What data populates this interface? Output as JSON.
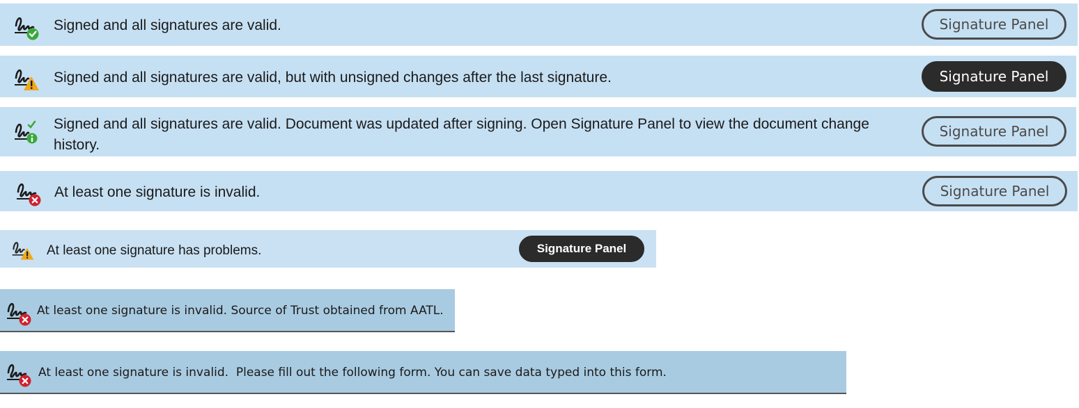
{
  "banners": [
    {
      "message": "Signed and all signatures are valid.",
      "button": "Signature Panel",
      "status_icon": "signature-valid-icon"
    },
    {
      "message": "Signed and all signatures are valid, but with unsigned changes after the last signature.",
      "button": "Signature Panel",
      "status_icon": "signature-warning-icon"
    },
    {
      "message": "Signed and all signatures are valid. Document was updated after signing. Open Signature Panel to view the document change history.",
      "button": "Signature Panel",
      "status_icon": "signature-info-icon"
    },
    {
      "message": "At least one signature is invalid.",
      "button": "Signature Panel",
      "status_icon": "signature-invalid-icon"
    },
    {
      "message": "At least one signature has problems.",
      "button": "Signature Panel",
      "status_icon": "signature-warning-icon"
    },
    {
      "message": "At least one signature is invalid. Source of Trust obtained from AATL.",
      "status_icon": "signature-invalid-icon"
    },
    {
      "message": "At least one signature is invalid.  Please fill out the following form. You can save data typed into this form.",
      "status_icon": "signature-invalid-icon"
    }
  ],
  "colors": {
    "banner_bg": "#c6e0f3",
    "legacy_banner_bg": "#a9cbe1",
    "valid": "#3aa83a",
    "warning": "#f0a81c",
    "invalid": "#d0202e",
    "button_dark": "#2b2b2b"
  }
}
